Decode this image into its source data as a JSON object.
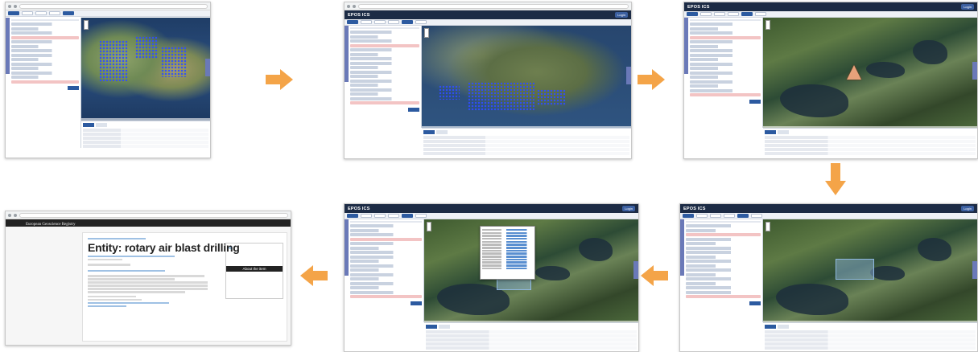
{
  "app": {
    "name": "EPOS ICS",
    "login_label": "Login"
  },
  "registry": {
    "site_title": "European Geoscience Registry",
    "entity_title": "Entity: rotary air blast drilling",
    "about_panel_title": "About the item",
    "share_icon": "share-icon"
  },
  "colors": {
    "arrow": "#f4a448",
    "app_header": "#1c2b45",
    "accent": "#2c5aa0",
    "highlight_marker": "#e8a17a"
  },
  "steps": [
    {
      "id": 1,
      "view": "world map with result markers"
    },
    {
      "id": 2,
      "view": "Scandinavia map with result markers"
    },
    {
      "id": 3,
      "view": "zoomed terrain with selected marker"
    },
    {
      "id": 4,
      "view": "zoomed terrain with drawn selection"
    },
    {
      "id": 5,
      "view": "zoomed terrain with feature popup"
    },
    {
      "id": 6,
      "view": "registry entity page"
    }
  ]
}
